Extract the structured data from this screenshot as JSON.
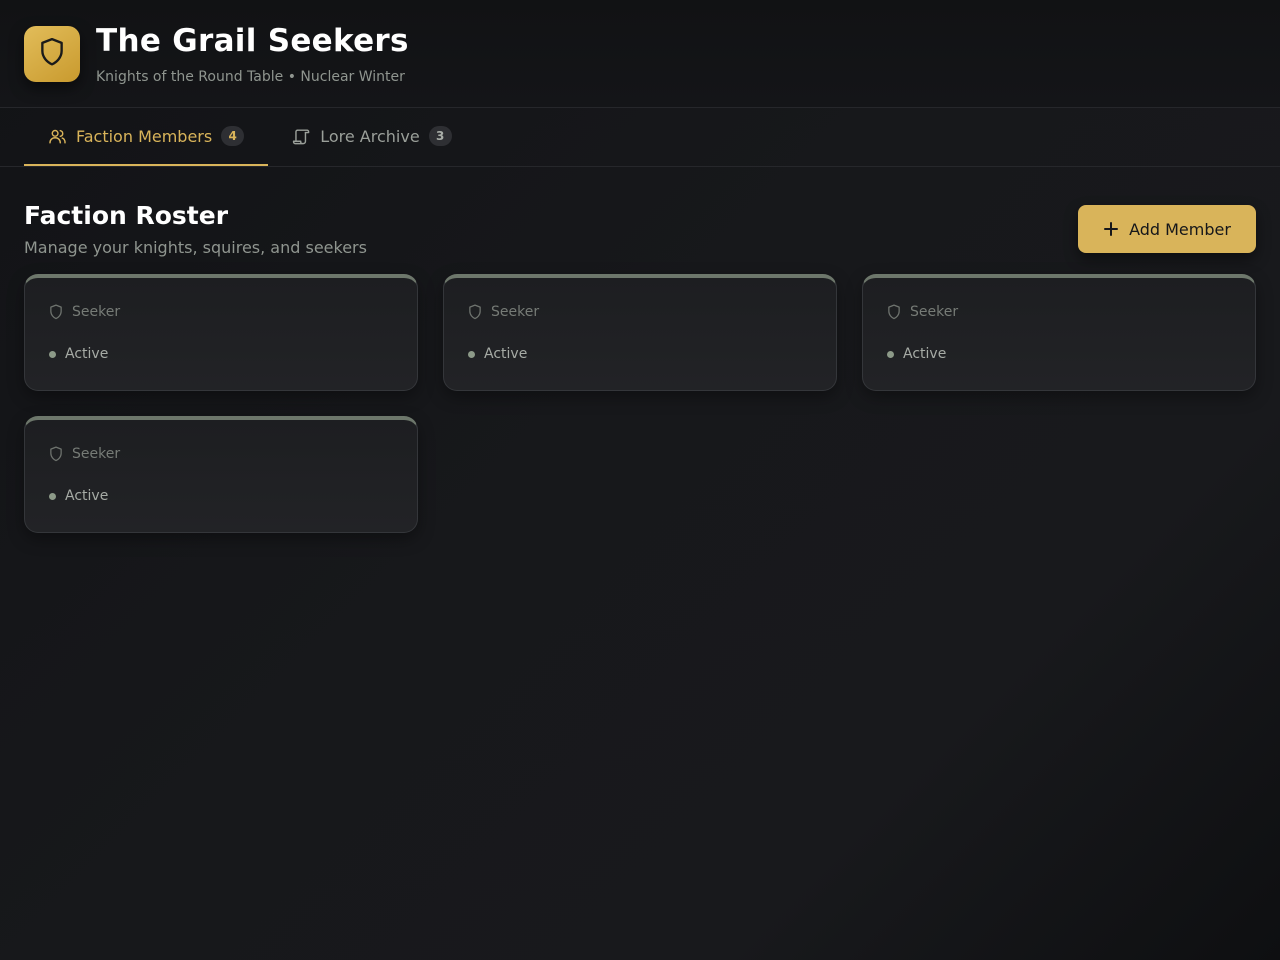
{
  "app": {
    "title": "The Grail Seekers",
    "subtitle": "Knights of the Round Table • Nuclear Winter",
    "logo_icon": "shield-icon",
    "accent_color": "#d9b45a"
  },
  "tabs": [
    {
      "label": "Faction Members",
      "count": "4",
      "icon": "users-icon",
      "active": true
    },
    {
      "label": "Lore Archive",
      "count": "3",
      "icon": "scroll-icon",
      "active": false
    }
  ],
  "section": {
    "title": "Faction Roster",
    "subtitle": "Manage your knights, squires, and seekers",
    "add_button_label": "Add Member"
  },
  "members": [
    {
      "role": "Seeker",
      "status": "Active"
    },
    {
      "role": "Seeker",
      "status": "Active"
    },
    {
      "role": "Seeker",
      "status": "Active"
    },
    {
      "role": "Seeker",
      "status": "Active"
    }
  ]
}
